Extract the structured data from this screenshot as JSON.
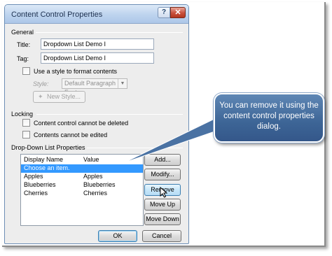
{
  "dialog": {
    "title": "Content Control Properties",
    "help_glyph": "?",
    "close_glyph": "✕"
  },
  "general": {
    "heading": "General",
    "title_label": "Title:",
    "title_value": "Dropdown List Demo I",
    "tag_label": "Tag:",
    "tag_value": "Dropdown List Demo I",
    "use_style_label": "Use a style to format contents",
    "use_style_checked": false,
    "style_label": "Style:",
    "style_value": "Default Paragraph Font",
    "new_style_label": "New Style..."
  },
  "locking": {
    "heading": "Locking",
    "cannot_delete_label": "Content control cannot be deleted",
    "cannot_delete_checked": false,
    "cannot_edit_label": "Contents cannot be edited",
    "cannot_edit_checked": false
  },
  "dropdown": {
    "heading": "Drop-Down List Properties",
    "columns": [
      "Display Name",
      "Value"
    ],
    "rows": [
      {
        "display": "Choose an item.",
        "value": "",
        "selected": true
      },
      {
        "display": "Apples",
        "value": "Apples",
        "selected": false
      },
      {
        "display": "Blueberries",
        "value": "Blueberries",
        "selected": false
      },
      {
        "display": "Cherries",
        "value": "Cherries",
        "selected": false
      }
    ],
    "buttons": {
      "add": "Add...",
      "modify": "Modify...",
      "remove": "Remove",
      "move_up": "Move Up",
      "move_down": "Move Down"
    }
  },
  "footer": {
    "ok": "OK",
    "cancel": "Cancel"
  },
  "callout": {
    "text": "You can remove it using the content control properties dialog."
  },
  "colors": {
    "selection": "#3399ff",
    "callout": "#3d6596",
    "titlebar": "#bdd3ee"
  }
}
